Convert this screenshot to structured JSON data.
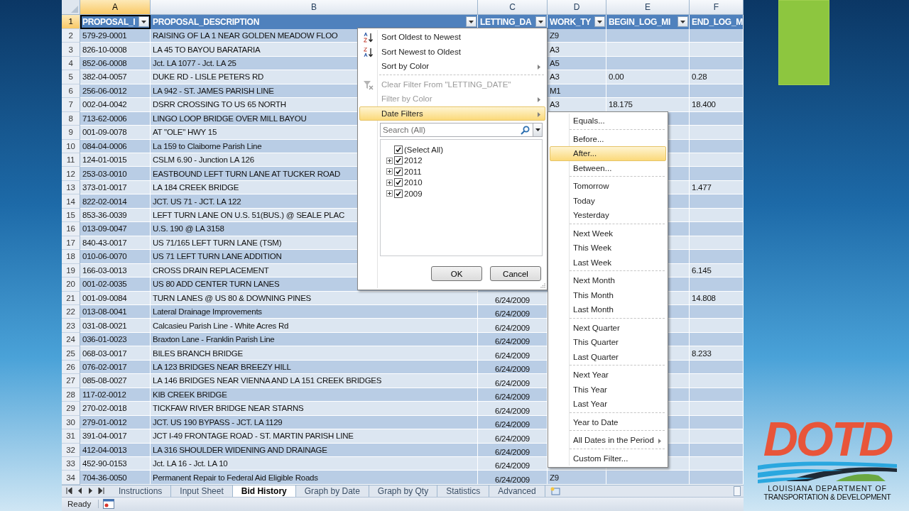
{
  "spreadsheet": {
    "column_letters": [
      {
        "label": "A",
        "selected": true
      },
      {
        "label": "B",
        "selected": false
      },
      {
        "label": "C",
        "selected": false
      },
      {
        "label": "D",
        "selected": false
      },
      {
        "label": "E",
        "selected": false
      },
      {
        "label": "F",
        "selected": false
      }
    ],
    "header_row": {
      "number": "1",
      "selected": true,
      "cells": [
        {
          "label": "PROPOSAL_I",
          "filter": true
        },
        {
          "label": "PROPOSAL_DESCRIPTION",
          "filter": true
        },
        {
          "label": "LETTING_DA",
          "filter": true
        },
        {
          "label": "WORK_TY",
          "filter": true
        },
        {
          "label": "BEGIN_LOG_MI",
          "filter": true
        },
        {
          "label": "END_LOG_M",
          "filter": false
        }
      ]
    },
    "rows": [
      {
        "number": "2",
        "id": "579-29-0001",
        "description": "RAISING OF LA 1 NEAR GOLDEN MEADOW FLOO",
        "work_type": "Z9"
      },
      {
        "number": "3",
        "id": "826-10-0008",
        "description": "LA 45 TO BAYOU BARATARIA",
        "work_type": "A3"
      },
      {
        "number": "4",
        "id": "852-06-0008",
        "description": "Jct. LA 1077 - Jct. LA 25",
        "work_type": "A5"
      },
      {
        "number": "5",
        "id": "382-04-0057",
        "description": "DUKE RD - LISLE PETERS RD",
        "work_type": "A3",
        "begin_log_mile": "0.00",
        "end_log_mile": "0.28"
      },
      {
        "number": "6",
        "id": "256-06-0012",
        "description": "LA 942 - ST. JAMES PARISH LINE",
        "work_type": "M1"
      },
      {
        "number": "7",
        "id": "002-04-0042",
        "description": "DSRR CROSSING TO US 65 NORTH",
        "work_type": "A3",
        "begin_log_mile": "18.175",
        "end_log_mile": "18.400"
      },
      {
        "number": "8",
        "id": "713-62-0006",
        "description": "LINGO LOOP BRIDGE OVER MILL BAYOU"
      },
      {
        "number": "9",
        "id": "001-09-0078",
        "description": "AT \"OLE\" HWY 15"
      },
      {
        "number": "10",
        "id": "084-04-0006",
        "description": "La 159 to Claiborne Parish Line"
      },
      {
        "number": "11",
        "id": "124-01-0015",
        "description": "CSLM 6.90 - Junction LA 126"
      },
      {
        "number": "12",
        "id": "253-03-0010",
        "description": "EASTBOUND LEFT TURN LANE AT TUCKER ROAD"
      },
      {
        "number": "13",
        "id": "373-01-0017",
        "description": "LA 184 CREEK BRIDGE",
        "end_log_mile": "1.477"
      },
      {
        "number": "14",
        "id": "822-02-0014",
        "description": "JCT. US 71 - JCT. LA 122"
      },
      {
        "number": "15",
        "id": "853-36-0039",
        "description": "LEFT TURN LANE ON U.S. 51(BUS.) @ SEALE PLAC"
      },
      {
        "number": "16",
        "id": "013-09-0047",
        "description": "U.S. 190 @ LA 3158"
      },
      {
        "number": "17",
        "id": "840-43-0017",
        "description": "US 71/165 LEFT TURN LANE (TSM)"
      },
      {
        "number": "18",
        "id": "010-06-0070",
        "description": "US 71 LEFT TURN LANE ADDITION"
      },
      {
        "number": "19",
        "id": "166-03-0013",
        "description": "CROSS DRAIN REPLACEMENT",
        "end_log_mile": "6.145"
      },
      {
        "number": "20",
        "id": "001-02-0035",
        "description": "US 80 ADD CENTER TURN LANES"
      },
      {
        "number": "21",
        "id": "001-09-0084",
        "description": "TURN LANES @ US 80 & DOWNING PINES",
        "letting_date": "6/24/2009",
        "end_log_mile": "14.808"
      },
      {
        "number": "22",
        "id": "013-08-0041",
        "description": "Lateral Drainage Improvements",
        "letting_date": "6/24/2009"
      },
      {
        "number": "23",
        "id": "031-08-0021",
        "description": "Calcasieu Parish Line - White Acres Rd",
        "letting_date": "6/24/2009"
      },
      {
        "number": "24",
        "id": "036-01-0023",
        "description": "Braxton Lane - Franklin Parish Line",
        "letting_date": "6/24/2009"
      },
      {
        "number": "25",
        "id": "068-03-0017",
        "description": "BILES BRANCH BRIDGE",
        "letting_date": "6/24/2009",
        "end_log_mile": "8.233"
      },
      {
        "number": "26",
        "id": "076-02-0017",
        "description": "LA 123 BRIDGES NEAR BREEZY HILL",
        "letting_date": "6/24/2009"
      },
      {
        "number": "27",
        "id": "085-08-0027",
        "description": "LA 146 BRIDGES NEAR VIENNA AND LA 151 CREEK BRIDGES",
        "letting_date": "6/24/2009"
      },
      {
        "number": "28",
        "id": "117-02-0012",
        "description": "KIB CREEK BRIDGE",
        "letting_date": "6/24/2009"
      },
      {
        "number": "29",
        "id": "270-02-0018",
        "description": "TICKFAW RIVER BRIDGE NEAR STARNS",
        "letting_date": "6/24/2009"
      },
      {
        "number": "30",
        "id": "279-01-0012",
        "description": "JCT. US 190 BYPASS - JCT. LA 1129",
        "letting_date": "6/24/2009"
      },
      {
        "number": "31",
        "id": "391-04-0017",
        "description": "JCT I-49 FRONTAGE ROAD - ST. MARTIN PARISH LINE",
        "letting_date": "6/24/2009"
      },
      {
        "number": "32",
        "id": "412-04-0013",
        "description": "LA 316 SHOULDER WIDENING AND DRAINAGE",
        "letting_date": "6/24/2009"
      },
      {
        "number": "33",
        "id": "452-90-0153",
        "description": "Jct. LA 16 - Jct. LA 10",
        "letting_date": "6/24/2009"
      },
      {
        "number": "34",
        "id": "704-36-0050",
        "description": "Permanent Repair to Federal Aid Eligible Roads",
        "letting_date": "6/24/2009",
        "work_type": "Z9"
      }
    ],
    "sheet_tabs": [
      {
        "label": "Instructions",
        "selected": false
      },
      {
        "label": "Input Sheet",
        "selected": false
      },
      {
        "label": "Bid History",
        "selected": true
      },
      {
        "label": "Graph by Date",
        "selected": false
      },
      {
        "label": "Graph by Qty",
        "selected": false
      },
      {
        "label": "Statistics",
        "selected": false
      },
      {
        "label": "Advanced",
        "selected": false
      }
    ],
    "status_bar": {
      "text": "Ready"
    }
  },
  "filter_menu": {
    "sections": [
      {
        "items": [
          {
            "label": "Sort Oldest to Newest",
            "kind": "sort_ascending",
            "disabled": false,
            "selected": false,
            "submenu": false
          },
          {
            "label": "Sort Newest to Oldest",
            "kind": "sort_descending",
            "disabled": false,
            "selected": false,
            "submenu": false
          },
          {
            "label": "Sort by Color",
            "kind": "plain",
            "disabled": false,
            "selected": false,
            "submenu": true
          }
        ]
      },
      {
        "items": [
          {
            "label": "Clear Filter From \"LETTING_DATE\"",
            "kind": "clear_filter",
            "disabled": true,
            "selected": false,
            "submenu": false
          },
          {
            "label": "Filter by Color",
            "kind": "plain",
            "disabled": true,
            "selected": false,
            "submenu": true
          },
          {
            "label": "Date Filters",
            "kind": "plain",
            "disabled": false,
            "selected": true,
            "submenu": true
          }
        ]
      }
    ],
    "search": {
      "placeholder": "Search (All)"
    },
    "values": [
      {
        "label": "(Select All)",
        "kind": "all",
        "checked": true
      },
      {
        "label": "2012",
        "kind": "year",
        "checked": true
      },
      {
        "label": "2011",
        "kind": "year",
        "checked": true
      },
      {
        "label": "2010",
        "kind": "year",
        "checked": true
      },
      {
        "label": "2009",
        "kind": "year",
        "checked": true
      }
    ],
    "buttons": [
      "OK",
      "Cancel"
    ]
  },
  "date_filters_menu": {
    "sections": [
      {
        "items": [
          {
            "label": "Equals...",
            "selected": false,
            "submenu": false
          }
        ]
      },
      {
        "items": [
          {
            "label": "Before...",
            "selected": false,
            "submenu": false
          },
          {
            "label": "After...",
            "selected": true,
            "submenu": false
          },
          {
            "label": "Between...",
            "selected": false,
            "submenu": false
          }
        ]
      },
      {
        "items": [
          {
            "label": "Tomorrow",
            "selected": false,
            "submenu": false
          },
          {
            "label": "Today",
            "selected": false,
            "submenu": false
          },
          {
            "label": "Yesterday",
            "selected": false,
            "submenu": false
          }
        ]
      },
      {
        "items": [
          {
            "label": "Next Week",
            "selected": false,
            "submenu": false
          },
          {
            "label": "This Week",
            "selected": false,
            "submenu": false
          },
          {
            "label": "Last Week",
            "selected": false,
            "submenu": false
          }
        ]
      },
      {
        "items": [
          {
            "label": "Next Month",
            "selected": false,
            "submenu": false
          },
          {
            "label": "This Month",
            "selected": false,
            "submenu": false
          },
          {
            "label": "Last Month",
            "selected": false,
            "submenu": false
          }
        ]
      },
      {
        "items": [
          {
            "label": "Next Quarter",
            "selected": false,
            "submenu": false
          },
          {
            "label": "This Quarter",
            "selected": false,
            "submenu": false
          },
          {
            "label": "Last Quarter",
            "selected": false,
            "submenu": false
          }
        ]
      },
      {
        "items": [
          {
            "label": "Next Year",
            "selected": false,
            "submenu": false
          },
          {
            "label": "This Year",
            "selected": false,
            "submenu": false
          },
          {
            "label": "Last Year",
            "selected": false,
            "submenu": false
          }
        ]
      },
      {
        "items": [
          {
            "label": "Year to Date",
            "selected": false,
            "submenu": false
          }
        ]
      },
      {
        "items": [
          {
            "label": "All Dates in the Period",
            "selected": false,
            "submenu": true
          }
        ]
      },
      {
        "items": [
          {
            "label": "Custom Filter...",
            "selected": false,
            "submenu": false
          }
        ]
      }
    ]
  },
  "logo": {
    "wordmark": "DOTD",
    "lines": [
      "LOUISIANA DEPARTMENT OF",
      "TRANSPORTATION & DEVELOPMENT"
    ]
  }
}
